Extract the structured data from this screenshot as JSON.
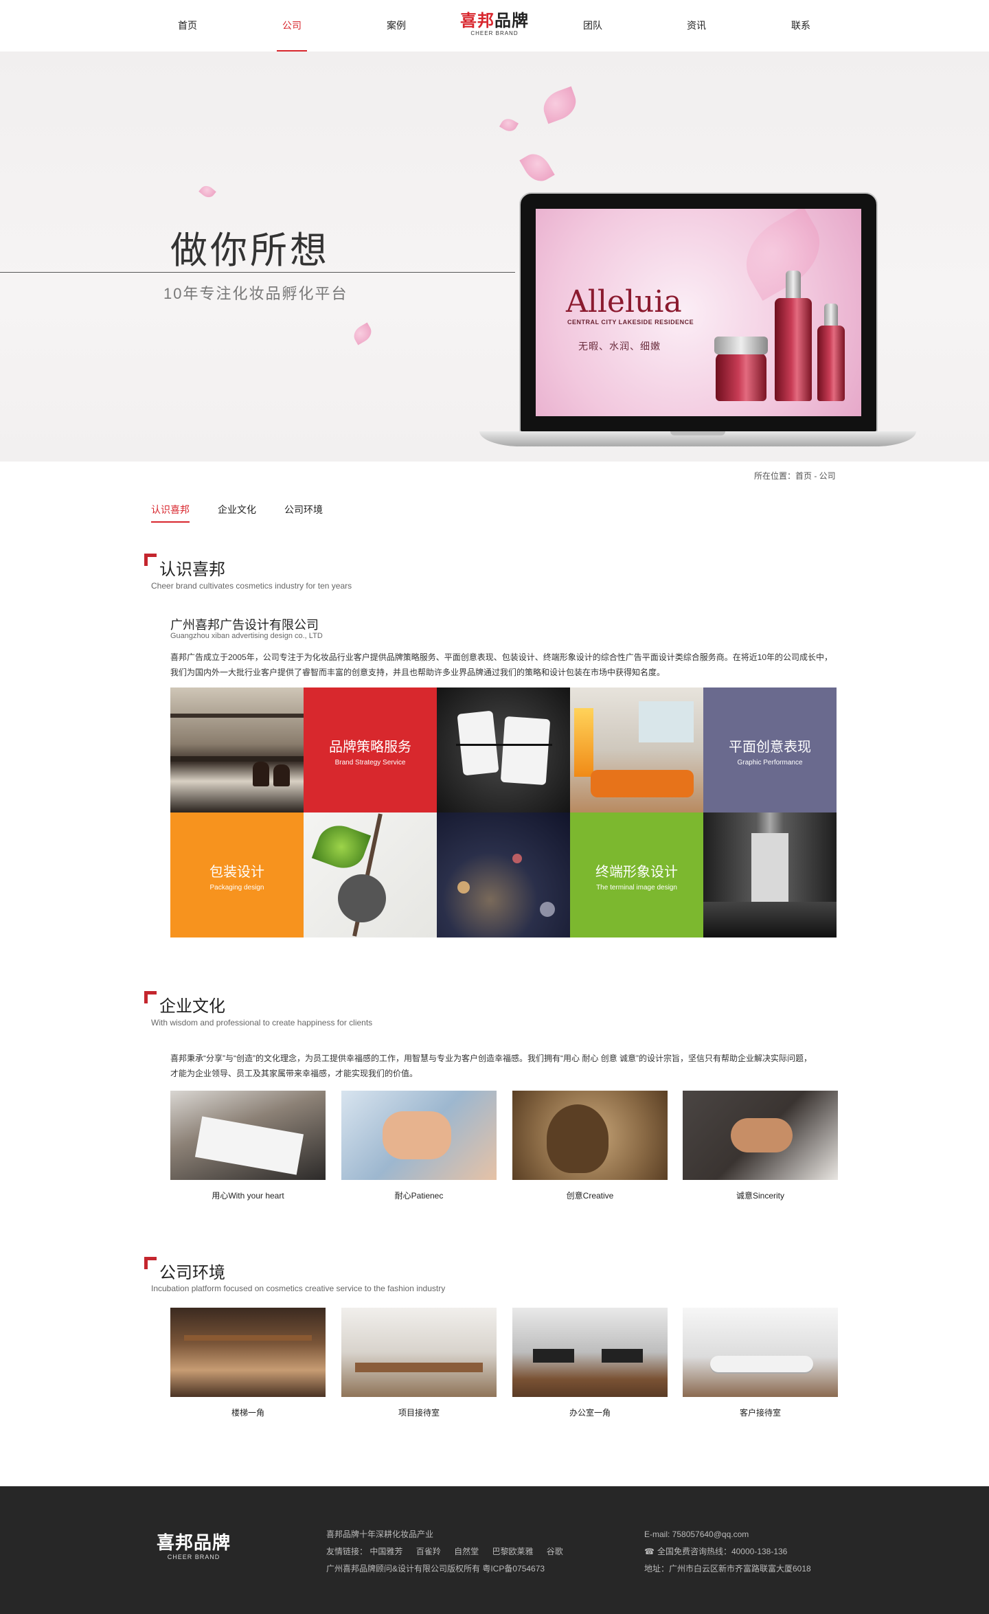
{
  "nav": {
    "items": [
      "首页",
      "公司",
      "案例",
      "团队",
      "资讯",
      "联系"
    ],
    "active": "公司"
  },
  "logo": {
    "mark_red": "喜邦",
    "mark_dark": "品牌",
    "sub": "CHEER BRAND"
  },
  "banner": {
    "title": "做你所想",
    "subtitle": "10年专注化妆品孵化平台",
    "screen": {
      "brand": "Alleluia",
      "brand_line2": "CENTRAL CITY LAKESIDE RESIDENCE",
      "tagline": "无暇、水润、细嫩"
    }
  },
  "breadcrumb": "所在位置：首页 - 公司",
  "tabs": [
    "认识喜邦",
    "企业文化",
    "公司环境"
  ],
  "about": {
    "title": "认识喜邦",
    "subtitle": "Cheer brand cultivates cosmetics industry for ten years",
    "company_name": "广州喜邦广告设计有限公司",
    "company_en": "Guangzhou xiban advertising design co., LTD",
    "paragraph": "喜邦广告成立于2005年，公司专注于为化妆品行业客户提供品牌策略服务、平面创意表现、包装设计、终端形象设计的综合性广告平面设计类综合服务商。在将近10年的公司成长中，我们为国内外一大批行业客户提供了睿智而丰富的创意支持，并且也帮助许多业界品牌通过我们的策略和设计包装在市场中获得知名度。",
    "services": [
      {
        "cn": "品牌策略服务",
        "en": "Brand Strategy Service",
        "color": "#d8282d"
      },
      {
        "cn": "平面创意表现",
        "en": "Graphic Performance",
        "color": "#6a6a8e"
      },
      {
        "cn": "包装设计",
        "en": "Packaging design",
        "color": "#f7931e"
      },
      {
        "cn": "终端形象设计",
        "en": "The terminal image design",
        "color": "#7cb82f"
      }
    ]
  },
  "culture": {
    "title": "企业文化",
    "subtitle": "With wisdom and professional to create happiness for clients",
    "paragraph": "喜邦秉承“分享”与“创造”的文化理念，为员工提供幸福感的工作，用智慧与专业为客户创造幸福感。我们拥有“用心 耐心 创意 诚意”的设计宗旨，坚信只有帮助企业解决实际问题，才能为企业领导、员工及其家属带来幸福感，才能实现我们的价值。",
    "cards": [
      "用心With your heart",
      "耐心Patienec",
      "创意Creative",
      "诚意Sincerity"
    ]
  },
  "environment": {
    "title": "公司环境",
    "subtitle": "Incubation platform focused on cosmetics creative service to the fashion industry",
    "cards": [
      "楼梯一角",
      "项目接待室",
      "办公室一角",
      "客户接待室"
    ]
  },
  "footer": {
    "logo_mark": "喜邦品牌",
    "logo_sub": "CHEER BRAND",
    "slogan": "喜邦品牌十年深耕化妆品产业",
    "links_label": "友情链接：",
    "links": [
      "中国雅芳",
      "百雀羚",
      "自然堂",
      "巴黎欧莱雅",
      "谷歌"
    ],
    "copyright": "广州喜邦品牌顾问&设计有限公司版权所有  粤ICP备0754673",
    "email": "E-mail: 758057640@qq.com",
    "hotline": "全国免费咨询热线：40000-138-136",
    "address": "地址：广州市白云区新市齐富路联富大厦6018"
  },
  "colors": {
    "accent": "#d8262d",
    "footer_bg": "#272727"
  }
}
